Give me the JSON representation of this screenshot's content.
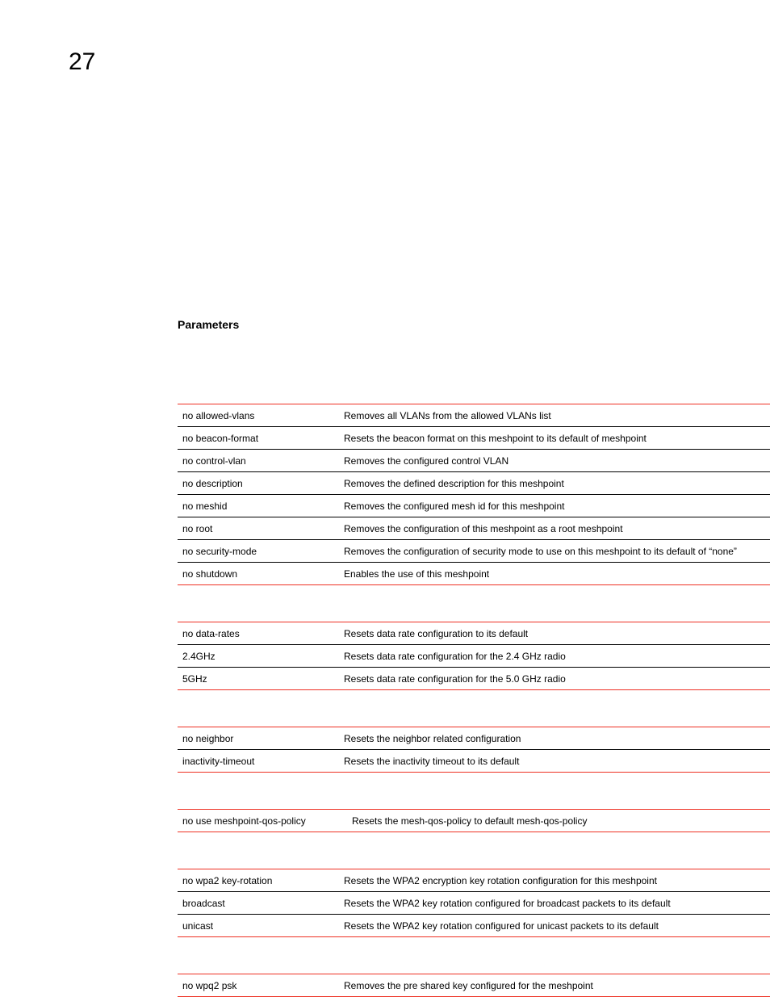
{
  "chapter_number": "27",
  "heading": "Parameters",
  "tables": [
    {
      "rows": [
        {
          "c1": "no allowed-vlans",
          "c2": "Removes all VLANs from the allowed VLANs list"
        },
        {
          "c1": "no beacon-format",
          "c2": "Resets the beacon format on this meshpoint to its default of meshpoint"
        },
        {
          "c1": "no control-vlan",
          "c2": "Removes the configured control VLAN"
        },
        {
          "c1": "no description",
          "c2": "Removes the defined description for this meshpoint"
        },
        {
          "c1": "no meshid",
          "c2": "Removes the configured mesh id for this meshpoint"
        },
        {
          "c1": "no root",
          "c2": "Removes the configuration of this meshpoint as a root meshpoint"
        },
        {
          "c1": "no security-mode",
          "c2": "Removes the configuration of security mode to use on this meshpoint to its default of “none”"
        },
        {
          "c1": "no shutdown",
          "c2": "Enables the use of this meshpoint"
        }
      ]
    },
    {
      "rows": [
        {
          "c1": "no data-rates",
          "c2": "Resets data rate configuration to its default"
        },
        {
          "c1": "2.4GHz",
          "c2": "Resets data rate configuration for the 2.4 GHz radio"
        },
        {
          "c1": "5GHz",
          "c2": "Resets data rate configuration for the 5.0 GHz radio"
        }
      ]
    },
    {
      "rows": [
        {
          "c1": "no neighbor",
          "c2": "Resets the neighbor related configuration"
        },
        {
          "c1": "inactivity-timeout",
          "c2": "Resets the inactivity timeout to its default"
        }
      ]
    },
    {
      "rows": [
        {
          "c1": "no use meshpoint-qos-policy",
          "c2": "Resets the mesh-qos-policy to default mesh-qos-policy",
          "wide": true
        }
      ]
    },
    {
      "rows": [
        {
          "c1": "no wpa2 key-rotation",
          "c2": "Resets the WPA2 encryption key rotation configuration for this meshpoint"
        },
        {
          "c1": "broadcast",
          "c2": "Resets the WPA2 key rotation configured for broadcast packets to its default"
        },
        {
          "c1": "unicast",
          "c2": "Resets the WPA2 key rotation configured for unicast packets to its default"
        }
      ]
    },
    {
      "rows": [
        {
          "c1": "no wpq2 psk",
          "c2": "Removes the pre shared key configured for the meshpoint"
        }
      ]
    }
  ]
}
